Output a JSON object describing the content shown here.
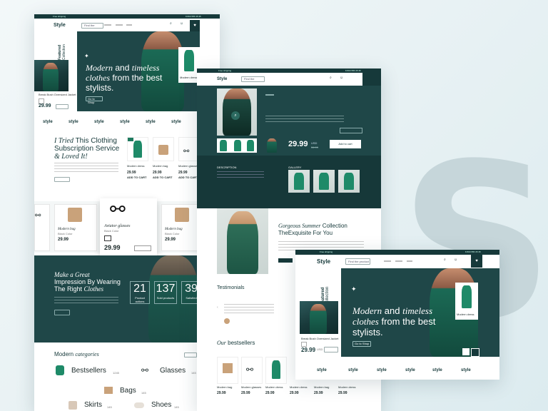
{
  "brand": {
    "logo": "Style",
    "watermark": "S"
  },
  "top_bar": {
    "promo": "Free shipping",
    "phone": "8 800 555 35 35"
  },
  "header": {
    "search_placeholder": "Find the product"
  },
  "hero": {
    "vertical_label_1": "Featured",
    "vertical_label_2": "Collection",
    "title_italic_1": "Modern",
    "title_normal_1": "and",
    "title_italic_2": "timeless",
    "title_italic_3": "clothes",
    "title_normal_2": "from the best stylists.",
    "product_name": "Break Bush Oversized Jacket",
    "price": "29.99",
    "price_currency": "USD",
    "button": "Go to Shop",
    "card_label": "Modern dress"
  },
  "brand_strip": [
    "style",
    "style",
    "style",
    "style",
    "style",
    "style"
  ],
  "blog": {
    "title_italic": "I Tried",
    "title_normal": "This Clothing Subscription Service",
    "title_italic_2": "& Loved It!",
    "products": [
      {
        "name": "Modern dress",
        "price": "29.99"
      },
      {
        "name": "Modern bag",
        "price": "29.99"
      },
      {
        "name": "Modern glasses",
        "price": "29.99"
      }
    ],
    "add_label": "ADD TO CART"
  },
  "carousel": {
    "items": [
      {
        "name": "Modern bag",
        "sub": "Black Color",
        "price": "29.99"
      },
      {
        "name": "Aviator glasses",
        "sub": "Black Color",
        "price": "29.99"
      },
      {
        "name": "Modern bag",
        "sub": "Black Color",
        "price": "29.99"
      }
    ]
  },
  "stats": {
    "title_1": "Make a Great",
    "title_2": "Impression By Wearing",
    "title_3": "The Right",
    "title_4": "Clothes",
    "numbers": [
      {
        "value": "21",
        "label": "Product actions"
      },
      {
        "value": "137",
        "label": "Sold products"
      },
      {
        "value": "39",
        "label": "Satisfied"
      }
    ]
  },
  "categories": {
    "title_normal": "Modern",
    "title_italic": "categories",
    "items": [
      {
        "name": "Bestsellers",
        "count": "1245"
      },
      {
        "name": "Glasses",
        "count": "145"
      },
      {
        "name": "Bags",
        "count": "145"
      },
      {
        "name": "Skirts",
        "count": "145"
      },
      {
        "name": "Shoes",
        "count": "145"
      }
    ]
  },
  "product_page": {
    "price": "29.99",
    "price_currency": "USD",
    "old_price": "34.99",
    "add_to_cart": "Add to cart",
    "description_label": "DESCRIPTION",
    "gallery_label": "GALLERY",
    "collection_title_italic": "Gorgeous Summer",
    "collection_title_normal": "Collection",
    "collection_subtitle": "TheExquisite For You",
    "testimonials": "Testimonials",
    "bestsellers_italic": "Our",
    "bestsellers_normal": "bestsellers",
    "grid": [
      {
        "name": "Modern bag",
        "price": "29.99"
      },
      {
        "name": "Modern glasses",
        "price": "29.99"
      },
      {
        "name": "Modern dress",
        "price": "29.99"
      },
      {
        "name": "Modern dress",
        "price": "29.99"
      },
      {
        "name": "Modern bag",
        "price": "29.99"
      },
      {
        "name": "Modern dress",
        "price": "29.99"
      }
    ]
  },
  "colors": {
    "primary": "#1f4748",
    "accent": "#1e8a68",
    "background": "#e9f2f4"
  }
}
